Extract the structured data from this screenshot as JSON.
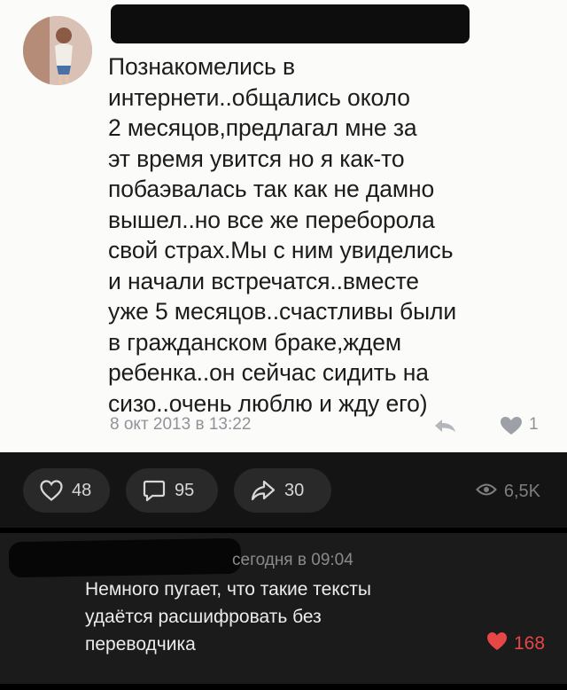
{
  "post": {
    "text": "Познакомелись в\nинтернети..общались около\n2 месяцов,предлагал мне за\nэт время увится но я как-то\nпобаэвалась так как не дамно\nвышел..но все же переборола\nсвой страх.Мы с ним увиделись\nи начали встречатся..вместе\nуже 5 месяцов..счастливы были\nв гражданском браке,ждем\nребенка..он сейчас сидить на\nсизо..очень люблю и жду его)",
    "date": "8 окт 2013 в 13:22",
    "likes": "1",
    "icons": {
      "reply": "reply-arrow-icon",
      "like": "heart-outline-icon"
    }
  },
  "actions": {
    "likes": "48",
    "comments": "95",
    "shares": "30",
    "views": "6,5K",
    "icons": {
      "like": "heart-icon",
      "comment": "comment-icon",
      "share": "share-icon",
      "views": "eye-icon"
    }
  },
  "comment": {
    "time": "сегодня в 09:04",
    "text": "Немного пугает, что такие тексты\nудаётся расшифровать без\nпереводчика",
    "likes": "168",
    "like_color": "#e64646"
  },
  "colors": {
    "dark_bg": "#141414",
    "pill": "#292929",
    "comment_bg": "#1b1b1b",
    "muted": "#8f9399"
  }
}
